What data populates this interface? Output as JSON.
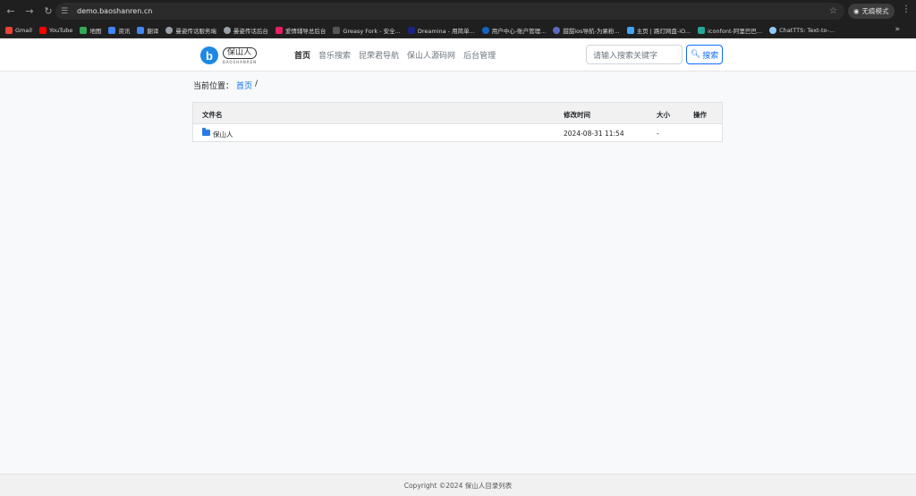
{
  "browser": {
    "url": "demo.baoshanren.cn",
    "incognito_label": "无痕模式",
    "bookmarks": [
      {
        "label": "Gmail",
        "color": "#ea4335"
      },
      {
        "label": "YouTube",
        "color": "#ff0000"
      },
      {
        "label": "地图",
        "color": "#34a853"
      },
      {
        "label": "资讯",
        "color": "#4285f4"
      },
      {
        "label": "翻译",
        "color": "#4285f4"
      },
      {
        "label": "曼姿传话服务端",
        "color": "#9aa0a6"
      },
      {
        "label": "曼姿传话后台",
        "color": "#9aa0a6"
      },
      {
        "label": "爱情辅导总后台",
        "color": "#e91e63"
      },
      {
        "label": "Greasy Fork - 安全...",
        "color": "#555555"
      },
      {
        "label": "Dreamina - 用简单...",
        "color": "#1a237e"
      },
      {
        "label": "用户中心-账户管理...",
        "color": "#1565c0"
      },
      {
        "label": "甜甜ios导航-为果粉...",
        "color": "#5c6bc0"
      },
      {
        "label": "主页 | 路灯网盘-iO...",
        "color": "#42a5f5"
      },
      {
        "label": "iconfont-阿里巴巴...",
        "color": "#26a69a"
      },
      {
        "label": "ChatTTS: Text-to-...",
        "color": "#90caf9"
      }
    ]
  },
  "header": {
    "logo_cn": "保山人",
    "logo_en": "BAOSHANREN",
    "nav": [
      "首页",
      "音乐搜索",
      "昆荣君导航",
      "保山人源码网",
      "后台管理"
    ],
    "search_placeholder": "请输入搜索关键字",
    "search_button": "搜索"
  },
  "breadcrumb": {
    "prefix": "当前位置：",
    "home": "首页",
    "sep": "/"
  },
  "table": {
    "columns": [
      "文件名",
      "修改时间",
      "大小",
      "操作"
    ],
    "rows": [
      {
        "name": "保山人",
        "modified": "2024-08-31 11:54",
        "size": "-",
        "action": ""
      }
    ]
  },
  "footer": {
    "text": "Copyright ©2024 保山人目录列表"
  }
}
